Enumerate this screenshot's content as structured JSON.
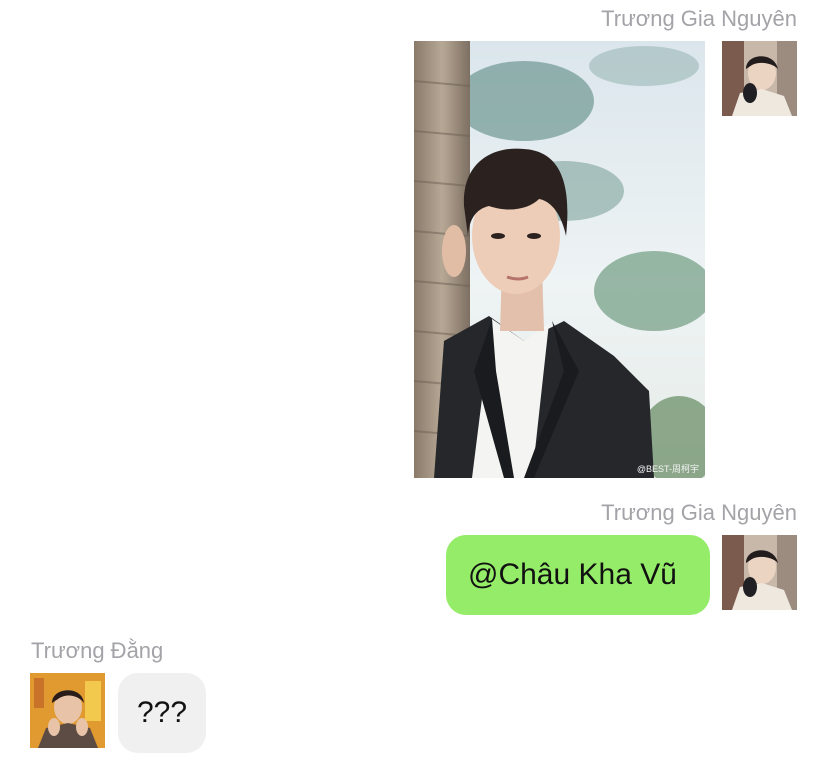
{
  "messages": [
    {
      "sender": "Trương Gia Nguyên",
      "direction": "outgoing",
      "type": "image",
      "avatar_icon": "avatar-photo-icon",
      "image_watermark": "@BEST-周柯宇"
    },
    {
      "sender": "Trương Gia Nguyên",
      "direction": "outgoing",
      "type": "text",
      "text": "@Châu Kha Vũ",
      "avatar_icon": "avatar-photo-icon"
    },
    {
      "sender": "Trương Đằng",
      "direction": "incoming",
      "type": "text",
      "text": "???",
      "avatar_icon": "avatar-photo-icon"
    }
  ],
  "colors": {
    "outgoing_bubble": "#95ec69",
    "incoming_bubble": "#f0f0f0",
    "sender_name": "#a3a3a8",
    "background": "#ffffff"
  }
}
